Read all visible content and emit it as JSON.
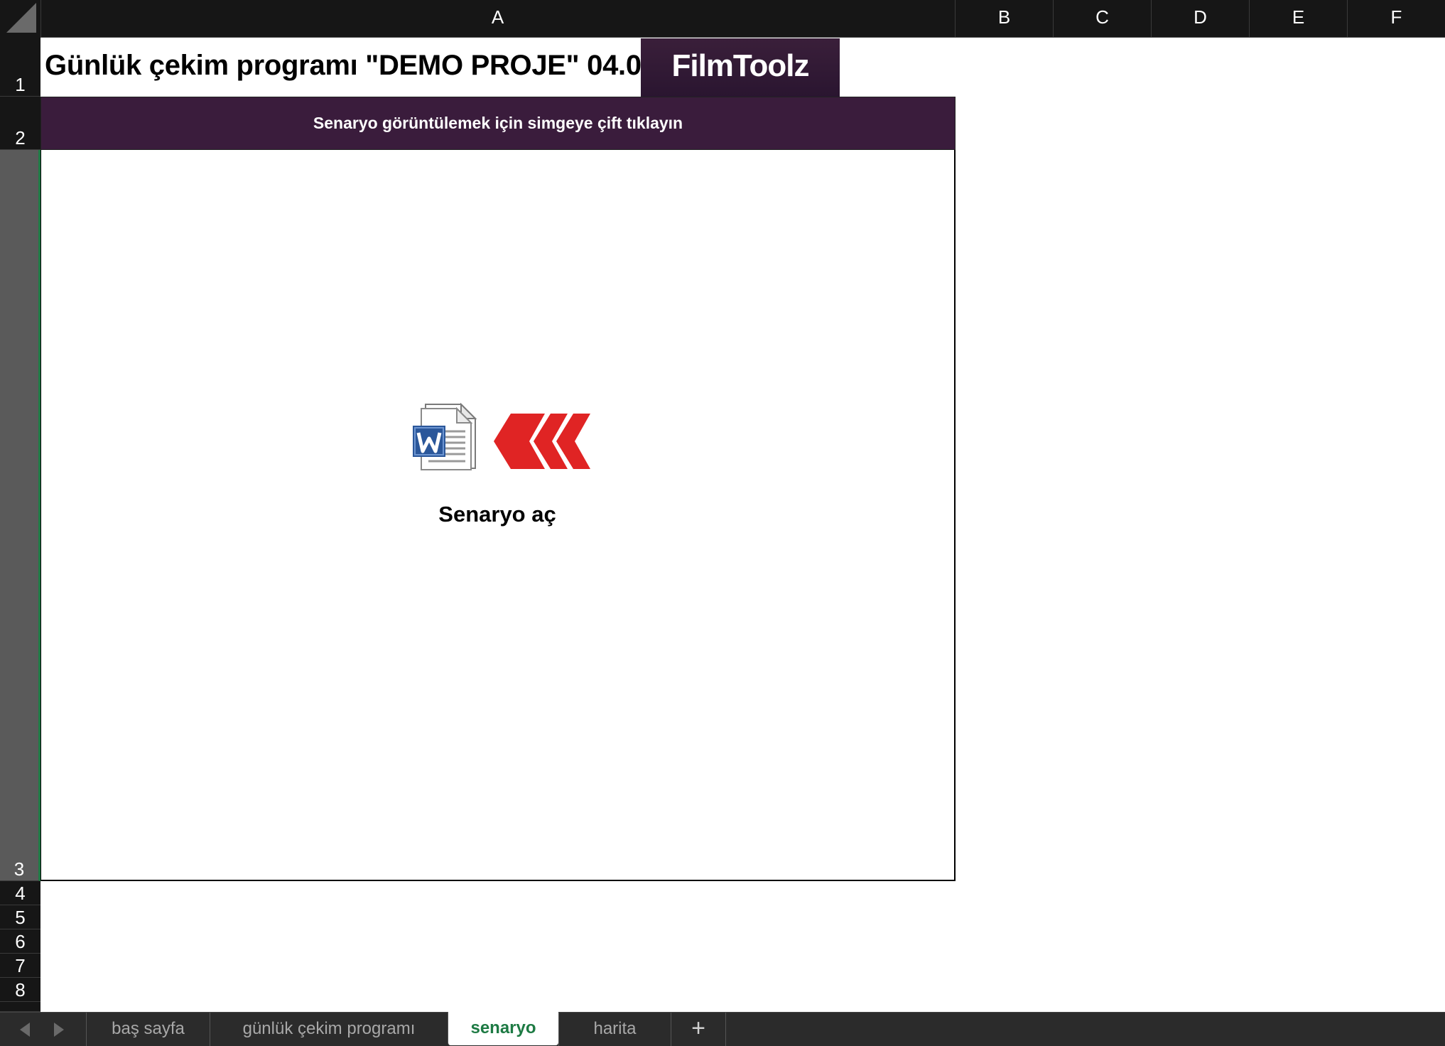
{
  "columns": [
    "A",
    "B",
    "C",
    "D",
    "E",
    "F"
  ],
  "rows": [
    "1",
    "2",
    "3",
    "4",
    "5",
    "6",
    "7",
    "8"
  ],
  "cells": {
    "title": "Günlük çekim programı \"DEMO PROJE\" 04.0",
    "logo_text": "FilmToolz",
    "header_band": "Senaryo görüntülemek için simgeye çift tıklayın",
    "open_label": "Senaryo aç"
  },
  "icons": {
    "document": "word-document-icon",
    "arrow": "red-double-chevron-left-icon"
  },
  "colors": {
    "header_band": "#3a1c3c",
    "logo_bg": "#2a1530",
    "accent_red": "#e02424",
    "active_tab": "#1d7a43",
    "word_blue": "#2b579a"
  },
  "tabs": [
    {
      "label": "baş sayfa",
      "active": false
    },
    {
      "label": "günlük çekim programı",
      "active": false
    },
    {
      "label": "senaryo",
      "active": true
    },
    {
      "label": "harita",
      "active": false
    }
  ],
  "add_tab_label": "+"
}
